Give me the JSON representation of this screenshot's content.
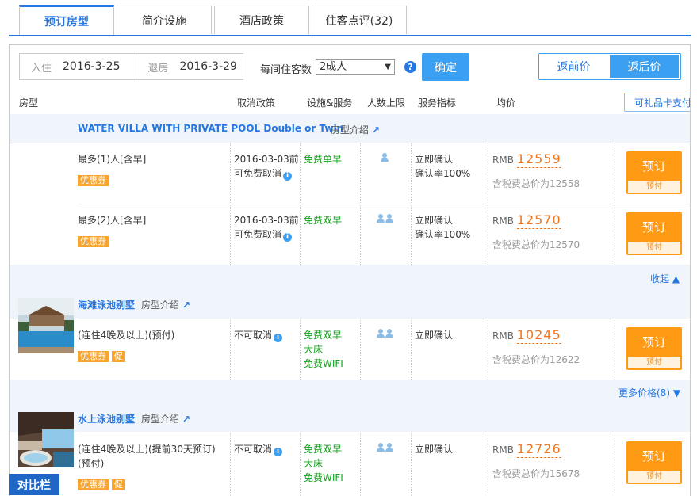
{
  "tabs": [
    {
      "label": "预订房型",
      "active": true
    },
    {
      "label": "简介设施",
      "active": false
    },
    {
      "label": "酒店政策",
      "active": false
    },
    {
      "label": "住客点评(32)",
      "active": false
    }
  ],
  "search": {
    "checkin_label": "入住",
    "checkin_value": "2016-3-25",
    "checkout_label": "退房",
    "checkout_value": "2016-3-29",
    "guests_label": "每间住客数",
    "guests_value": "2成人",
    "help": "?",
    "confirm_label": "确定",
    "toggle_before": "返前价",
    "toggle_after": "返后价"
  },
  "columns": {
    "room": "房型",
    "cancel": "取消政策",
    "facility": "设施&服务",
    "people": "人数上限",
    "service": "服务指标",
    "price": "均价",
    "gift_card": "可礼品卡支付"
  },
  "common": {
    "coupon": "优惠券",
    "promo": "促",
    "book": "预订",
    "prepay": "预付",
    "rmb": "RMB",
    "intro": "房型介绍",
    "intro_arrow": "↗",
    "info": "i"
  },
  "rooms": [
    {
      "title": "WATER VILLA WITH PRIVATE POOL Double or Twin",
      "rows": [
        {
          "desc": "最多(1)人[含早]",
          "cancel1": "2016-03-03前",
          "cancel2": "可免费取消",
          "facility": [
            "免费单早"
          ],
          "service1": "立即确认",
          "service2": "确认率100%",
          "price": "12559",
          "tax": "含税费总价为12558"
        },
        {
          "desc": "最多(2)人[含早]",
          "cancel1": "2016-03-03前",
          "cancel2": "可免费取消",
          "facility": [
            "免费双早"
          ],
          "service1": "立即确认",
          "service2": "确认率100%",
          "price": "12570",
          "tax": "含税费总价为12570"
        }
      ],
      "more": "收起 ▲"
    },
    {
      "title": "海滩泳池别墅",
      "rows": [
        {
          "desc": "(连住4晚及以上)(预付)",
          "cancel": "不可取消",
          "facility": [
            "免费双早",
            "大床",
            "免费WIFI"
          ],
          "service1": "立即确认",
          "price": "10245",
          "tax": "含税费总价为12622"
        }
      ],
      "more": "更多价格(8) ▼"
    },
    {
      "title": "水上泳池别墅",
      "rows": [
        {
          "desc1": "(连住4晚及以上)(提前30天预订)",
          "desc2": "(预付)",
          "cancel": "不可取消",
          "facility": [
            "免费双早",
            "大床",
            "免费WIFI"
          ],
          "service1": "立即确认",
          "price": "12726",
          "tax": "含税费总价为15678"
        }
      ]
    }
  ],
  "compare_label": "对比栏",
  "colors": {
    "accent": "#2577e3",
    "button": "#3ca0f2",
    "book": "#ff9a14",
    "price": "#f0751f",
    "green": "#14a31c"
  }
}
